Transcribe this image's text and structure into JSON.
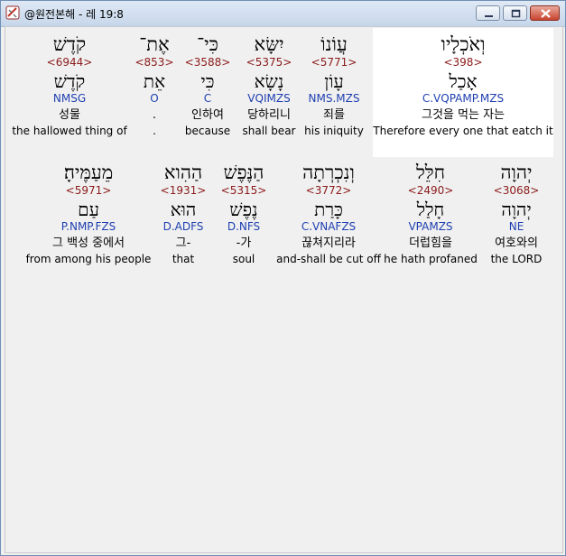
{
  "window": {
    "title": "@원전본해 - 레 19:8"
  },
  "icons": {
    "app": "app-icon",
    "minimize": "minimize-icon",
    "maximize": "maximize-icon",
    "close": "close-icon"
  },
  "colors": {
    "strong": "#8b1a1a",
    "morph": "#1f3fb0",
    "highlight": "#ffffff"
  },
  "row1": [
    {
      "hebrew": "וְאֹכְלָיו",
      "strong": "<398>",
      "lemma": "אָכַל",
      "morph": "C.VQPAMP.MZS",
      "korean": "그것을 먹는 자는",
      "english": "Therefore every one that eatch it",
      "highlighted": true
    },
    {
      "hebrew": "עֲוֹנוֹ",
      "strong": "<5771>",
      "lemma": "עָוֹן",
      "morph": "NMS.MZS",
      "korean": "죄를",
      "english": "his iniquity"
    },
    {
      "hebrew": "יִשָּׂא",
      "strong": "<5375>",
      "lemma": "נָשָׂא",
      "morph": "VQIMZS",
      "korean": "당하리니",
      "english": "shall bear"
    },
    {
      "hebrew": "כִּי־",
      "strong": "<3588>",
      "lemma": "כִּי",
      "morph": "C",
      "korean": "인하여",
      "english": "because"
    },
    {
      "hebrew": "אֶת־",
      "strong": "<853>",
      "lemma": "אֵת",
      "morph": "O",
      "korean": ".",
      "english": "."
    },
    {
      "hebrew": "קֹדֶשׁ",
      "strong": "<6944>",
      "lemma": "קֹדֶשׁ",
      "morph": "NMSG",
      "korean": "성물",
      "english": "the hallowed thing of"
    }
  ],
  "row2": [
    {
      "hebrew": "יְהוָה",
      "strong": "<3068>",
      "lemma": "יְהוָה",
      "morph": "NE",
      "korean": "여호와의",
      "english": "the LORD"
    },
    {
      "hebrew": "חִלֵּל",
      "strong": "<2490>",
      "lemma": "חָלַל",
      "morph": "VPAMZS",
      "korean": "더럽힘을",
      "english": "he hath profaned"
    },
    {
      "hebrew": "וְנִכְרְתָה",
      "strong": "<3772>",
      "lemma": "כָּרַת",
      "morph": "C.VNAFZS",
      "korean": "끊쳐지리라",
      "english": "and-shall be cut off"
    },
    {
      "hebrew": "הַנֶּפֶשׁ",
      "strong": "<5315>",
      "lemma": "נֶפֶשׁ",
      "morph": "D.NFS",
      "korean": "-가",
      "english": "soul"
    },
    {
      "hebrew": "הַהִוא",
      "strong": "<1931>",
      "lemma": "הוּא",
      "morph": "D.ADFS",
      "korean": "그-",
      "english": "that"
    },
    {
      "hebrew": "מֵעַמֶּיהָ׃",
      "strong": "<5971>",
      "lemma": "עַם",
      "morph": "P.NMP.FZS",
      "korean": "그 백성 중에서",
      "english": "from among his people"
    }
  ]
}
